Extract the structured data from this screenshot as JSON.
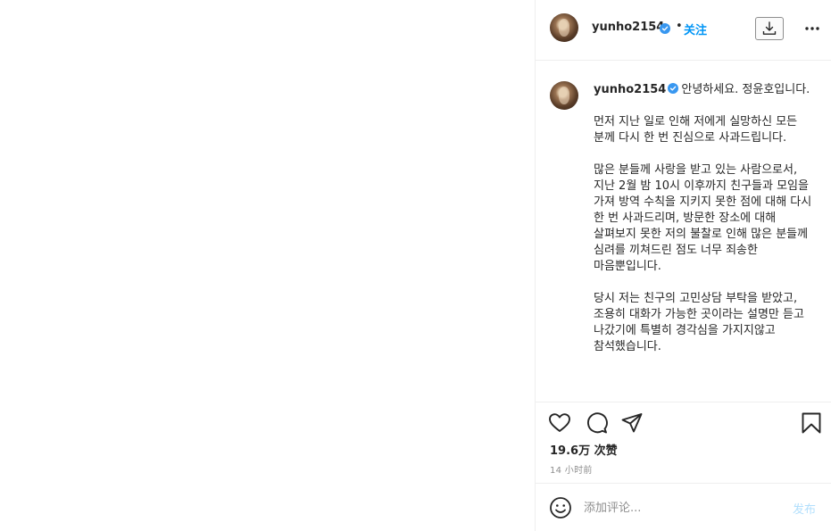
{
  "post": {
    "author": "yunho2154",
    "follow_label": "关注",
    "separator": "•",
    "caption_text": "안녕하세요. 정윤호입니다.\n\n먼저 지난 일로 인해 저에게 실망하신 모든 분께 다시 한 번 진심으로 사과드립니다.\n\n많은 분들께 사랑을 받고 있는 사람으로서, 지난 2월 밤 10시 이후까지 친구들과 모임을 가져 방역 수칙을 지키지 못한 점에 대해 다시 한 번 사과드리며, 방문한 장소에 대해 살펴보지 못한 저의 불찰로 인해 많은 분들께 심려를 끼쳐드린 점도 너무 죄송한 마음뿐입니다.\n\n당시 저는 친구의 고민상담 부탁을 받았고, 조용히 대화가 가능한 곳이라는 설명만 듣고 나갔기에 특별히 경각심을 가지지않고 참석했습니다.",
    "likes": "19.6万 次赞",
    "time_ago": "14 小时前"
  },
  "comment": {
    "placeholder": "添加评论...",
    "post_label": "发布"
  },
  "colors": {
    "accent": "#0095f6",
    "verified": "#3897f0",
    "post_disabled": "#b2dffc",
    "muted": "#8e8e8e",
    "border": "#efefef"
  },
  "icons": [
    "download-icon",
    "more-options-icon",
    "heart-icon",
    "comment-icon",
    "share-icon",
    "bookmark-icon",
    "emoji-icon",
    "verified-icon"
  ]
}
